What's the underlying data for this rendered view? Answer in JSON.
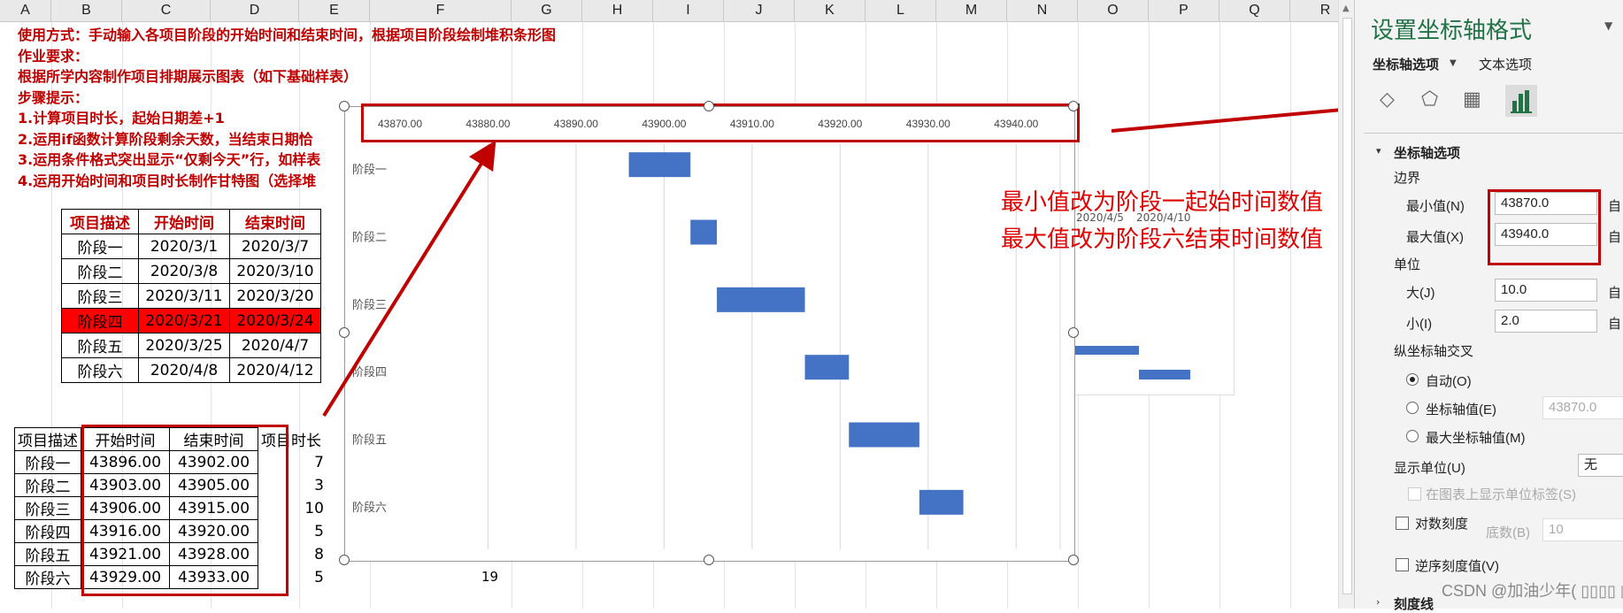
{
  "columns": [
    "A",
    "B",
    "C",
    "D",
    "E",
    "F",
    "G",
    "H",
    "I",
    "J",
    "K",
    "L",
    "M",
    "N",
    "O",
    "P",
    "Q",
    "R"
  ],
  "instructions": [
    "使用方式：手动输入各项目阶段的开始时间和结束时间，根据项目阶段绘制堆积条形图",
    "作业要求：",
    "根据所学内容制作项目排期展示图表（如下基础样表）",
    "步骤提示：",
    "1.计算项目时长，起始日期差+1",
    "2.运用if函数计算阶段剩余天数，当结束日期恰",
    "3.运用条件格式突出显示“仅剩今天”行，如样表",
    "4.运用开始时间和项目时长制作甘特图（选择堆"
  ],
  "table1": {
    "headers": [
      "项目描述",
      "开始时间",
      "结束时间"
    ],
    "rows": [
      [
        "阶段一",
        "2020/3/1",
        "2020/3/7"
      ],
      [
        "阶段二",
        "2020/3/8",
        "2020/3/10"
      ],
      [
        "阶段三",
        "2020/3/11",
        "2020/3/20"
      ],
      [
        "阶段四",
        "2020/3/21",
        "2020/3/24"
      ],
      [
        "阶段五",
        "2020/3/25",
        "2020/4/7"
      ],
      [
        "阶段六",
        "2020/4/8",
        "2020/4/12"
      ]
    ],
    "highlight_row": 3,
    "highlight_color": "#ff0000"
  },
  "table2": {
    "headers": [
      "项目描述",
      "开始时间",
      "结束时间",
      "项目时长"
    ],
    "rows": [
      [
        "阶段一",
        "43896.00",
        "43902.00",
        "7"
      ],
      [
        "阶段二",
        "43903.00",
        "43905.00",
        "3"
      ],
      [
        "阶段三",
        "43906.00",
        "43915.00",
        "10"
      ],
      [
        "阶段四",
        "43916.00",
        "43920.00",
        "5"
      ],
      [
        "阶段五",
        "43921.00",
        "43928.00",
        "8"
      ],
      [
        "阶段六",
        "43929.00",
        "43933.00",
        "5"
      ]
    ]
  },
  "cell_19": "19",
  "chart_data": {
    "type": "bar",
    "orientation": "horizontal-gantt",
    "categories": [
      "阶段一",
      "阶段二",
      "阶段三",
      "阶段四",
      "阶段五",
      "阶段六"
    ],
    "series": [
      {
        "start": [
          43896,
          43903,
          43906,
          43916,
          43921,
          43929
        ],
        "end": [
          43903,
          43906,
          43916,
          43921,
          43929,
          43934
        ]
      }
    ],
    "xlim": [
      43870,
      43945
    ],
    "xticks": [
      "43870.00",
      "43880.00",
      "43890.00",
      "43900.00",
      "43910.00",
      "43920.00",
      "43930.00",
      "43940.00"
    ],
    "xtick_values": [
      43870,
      43880,
      43890,
      43900,
      43910,
      43920,
      43930,
      43940
    ],
    "bar_color": "#4472c4",
    "grid": true
  },
  "bg_chart": {
    "labels": [
      "2020/4/5",
      "2020/4/10"
    ]
  },
  "annotations": [
    "最小值改为阶段一起始时间数值",
    "最大值改为阶段六结束时间数值"
  ],
  "annotation_color": "#e00000",
  "panel": {
    "title": "设置坐标轴格式",
    "tab_axis": "坐标轴选项",
    "tab_text": "文本选项",
    "section": "坐标轴选项",
    "bounds_label": "边界",
    "min_label": "最小值(N)",
    "min_value": "43870.0",
    "max_label": "最大值(X)",
    "max_value": "43940.0",
    "auto_btn": "自",
    "unit_label": "单位",
    "major_label": "大(J)",
    "major_value": "10.0",
    "minor_label": "小(I)",
    "minor_value": "2.0",
    "cross_label": "纵坐标轴交叉",
    "opt_auto": "自动(O)",
    "opt_value": "坐标轴值(E)",
    "opt_value_field": "43870.0",
    "opt_max": "最大坐标轴值(M)",
    "display_unit_label": "显示单位(U)",
    "display_unit_value": "无",
    "show_unit_label": "在图表上显示单位标签(S)",
    "log_label": "对数刻度",
    "base_label": "底数(B)",
    "base_value": "10",
    "reverse_label": "逆序刻度值(V)",
    "tick_label": "刻度线",
    "watermark": "CSDN @加油少年( ▯▯▯▯ ▯ ▯▯▯▯ )"
  }
}
